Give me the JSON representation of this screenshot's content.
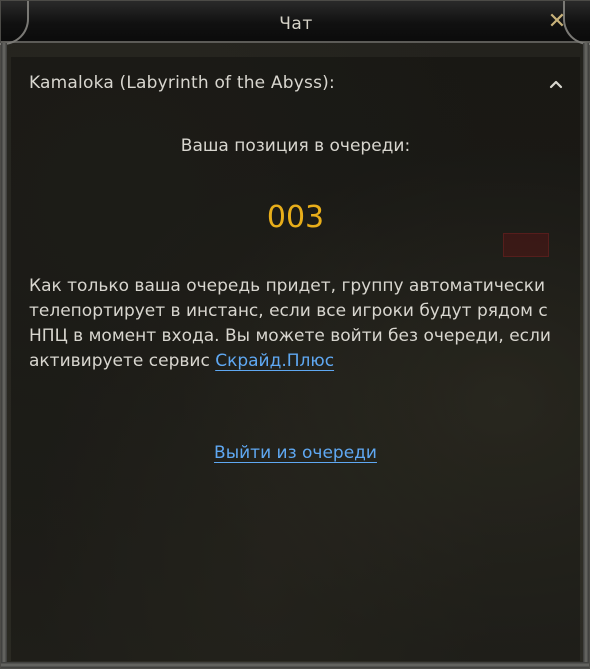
{
  "window": {
    "title": "Чат",
    "close_icon": "close-icon"
  },
  "panel": {
    "header_title": "Kamaloka (Labyrinth of the Abyss):",
    "collapse_icon": "chevron-up-icon",
    "queue_label": "Ваша позиция в очереди:",
    "queue_position": "003",
    "message_text": "Как только ваша очередь придет, группу автоматически телепортирует в инстанс, если все игроки будут рядом с НПЦ в момент входа. Вы можете войти без очереди, если активируете сервис",
    "service_link": "Скрайд.Плюс",
    "leave_queue_link": "Выйти из очереди"
  },
  "colors": {
    "queue_number": "#e8ae1a",
    "link": "#5fa8f2",
    "text": "#d8d6cf",
    "close_icon": "#c8b27a"
  }
}
